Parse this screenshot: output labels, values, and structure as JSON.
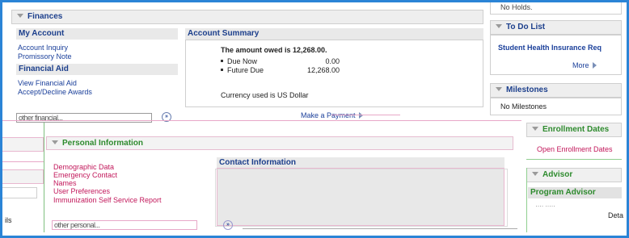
{
  "finances": {
    "header": "Finances",
    "my_account": {
      "title": "My Account",
      "links": [
        "Account Inquiry",
        "Promissory Note"
      ]
    },
    "financial_aid": {
      "title": "Financial Aid",
      "links": [
        "View Financial Aid",
        "Accept/Decline Awards"
      ]
    },
    "select_value": "other financial...",
    "go_label": "»",
    "account_summary": {
      "title": "Account Summary",
      "owed_text": "The amount owed is 12,268.00.",
      "rows": [
        {
          "label": "Due Now",
          "value": "0.00"
        },
        {
          "label": "Future Due",
          "value": "12,268.00"
        }
      ],
      "currency_text": "Currency used is US Dollar"
    },
    "make_payment": "Make a Payment"
  },
  "holds": {
    "text": "No Holds."
  },
  "todo": {
    "header": "To Do List",
    "item": "Student Health Insurance Req",
    "more": "More"
  },
  "milestones": {
    "header": "Milestones",
    "text": "No Milestones"
  },
  "enrollment_dates": {
    "header": "Enrollment Dates",
    "link": "Open Enrollment Dates"
  },
  "advisor": {
    "header": "Advisor",
    "program_advisor": "Program Advisor",
    "name_blurred": "···· ·····"
  },
  "personal_information": {
    "header": "Personal Information",
    "links": [
      "Demographic Data",
      "Emergency Contact",
      "Names",
      "User Preferences",
      "Immunization Self Service Report"
    ],
    "contact_title": "Contact Information",
    "select_value": "other personal..."
  },
  "left_edge": {
    "details_label": "ils"
  },
  "right_edge": {
    "details_label": "Deta"
  }
}
